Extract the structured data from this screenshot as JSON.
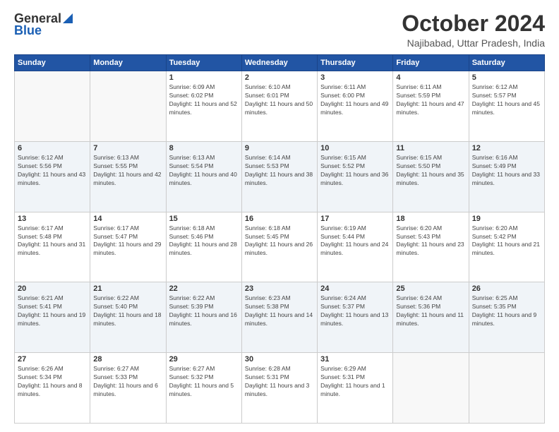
{
  "header": {
    "logo_general": "General",
    "logo_blue": "Blue",
    "title": "October 2024",
    "subtitle": "Najibabad, Uttar Pradesh, India"
  },
  "calendar": {
    "days_of_week": [
      "Sunday",
      "Monday",
      "Tuesday",
      "Wednesday",
      "Thursday",
      "Friday",
      "Saturday"
    ],
    "weeks": [
      [
        {
          "day": "",
          "info": ""
        },
        {
          "day": "",
          "info": ""
        },
        {
          "day": "1",
          "info": "Sunrise: 6:09 AM\nSunset: 6:02 PM\nDaylight: 11 hours and 52 minutes."
        },
        {
          "day": "2",
          "info": "Sunrise: 6:10 AM\nSunset: 6:01 PM\nDaylight: 11 hours and 50 minutes."
        },
        {
          "day": "3",
          "info": "Sunrise: 6:11 AM\nSunset: 6:00 PM\nDaylight: 11 hours and 49 minutes."
        },
        {
          "day": "4",
          "info": "Sunrise: 6:11 AM\nSunset: 5:59 PM\nDaylight: 11 hours and 47 minutes."
        },
        {
          "day": "5",
          "info": "Sunrise: 6:12 AM\nSunset: 5:57 PM\nDaylight: 11 hours and 45 minutes."
        }
      ],
      [
        {
          "day": "6",
          "info": "Sunrise: 6:12 AM\nSunset: 5:56 PM\nDaylight: 11 hours and 43 minutes."
        },
        {
          "day": "7",
          "info": "Sunrise: 6:13 AM\nSunset: 5:55 PM\nDaylight: 11 hours and 42 minutes."
        },
        {
          "day": "8",
          "info": "Sunrise: 6:13 AM\nSunset: 5:54 PM\nDaylight: 11 hours and 40 minutes."
        },
        {
          "day": "9",
          "info": "Sunrise: 6:14 AM\nSunset: 5:53 PM\nDaylight: 11 hours and 38 minutes."
        },
        {
          "day": "10",
          "info": "Sunrise: 6:15 AM\nSunset: 5:52 PM\nDaylight: 11 hours and 36 minutes."
        },
        {
          "day": "11",
          "info": "Sunrise: 6:15 AM\nSunset: 5:50 PM\nDaylight: 11 hours and 35 minutes."
        },
        {
          "day": "12",
          "info": "Sunrise: 6:16 AM\nSunset: 5:49 PM\nDaylight: 11 hours and 33 minutes."
        }
      ],
      [
        {
          "day": "13",
          "info": "Sunrise: 6:17 AM\nSunset: 5:48 PM\nDaylight: 11 hours and 31 minutes."
        },
        {
          "day": "14",
          "info": "Sunrise: 6:17 AM\nSunset: 5:47 PM\nDaylight: 11 hours and 29 minutes."
        },
        {
          "day": "15",
          "info": "Sunrise: 6:18 AM\nSunset: 5:46 PM\nDaylight: 11 hours and 28 minutes."
        },
        {
          "day": "16",
          "info": "Sunrise: 6:18 AM\nSunset: 5:45 PM\nDaylight: 11 hours and 26 minutes."
        },
        {
          "day": "17",
          "info": "Sunrise: 6:19 AM\nSunset: 5:44 PM\nDaylight: 11 hours and 24 minutes."
        },
        {
          "day": "18",
          "info": "Sunrise: 6:20 AM\nSunset: 5:43 PM\nDaylight: 11 hours and 23 minutes."
        },
        {
          "day": "19",
          "info": "Sunrise: 6:20 AM\nSunset: 5:42 PM\nDaylight: 11 hours and 21 minutes."
        }
      ],
      [
        {
          "day": "20",
          "info": "Sunrise: 6:21 AM\nSunset: 5:41 PM\nDaylight: 11 hours and 19 minutes."
        },
        {
          "day": "21",
          "info": "Sunrise: 6:22 AM\nSunset: 5:40 PM\nDaylight: 11 hours and 18 minutes."
        },
        {
          "day": "22",
          "info": "Sunrise: 6:22 AM\nSunset: 5:39 PM\nDaylight: 11 hours and 16 minutes."
        },
        {
          "day": "23",
          "info": "Sunrise: 6:23 AM\nSunset: 5:38 PM\nDaylight: 11 hours and 14 minutes."
        },
        {
          "day": "24",
          "info": "Sunrise: 6:24 AM\nSunset: 5:37 PM\nDaylight: 11 hours and 13 minutes."
        },
        {
          "day": "25",
          "info": "Sunrise: 6:24 AM\nSunset: 5:36 PM\nDaylight: 11 hours and 11 minutes."
        },
        {
          "day": "26",
          "info": "Sunrise: 6:25 AM\nSunset: 5:35 PM\nDaylight: 11 hours and 9 minutes."
        }
      ],
      [
        {
          "day": "27",
          "info": "Sunrise: 6:26 AM\nSunset: 5:34 PM\nDaylight: 11 hours and 8 minutes."
        },
        {
          "day": "28",
          "info": "Sunrise: 6:27 AM\nSunset: 5:33 PM\nDaylight: 11 hours and 6 minutes."
        },
        {
          "day": "29",
          "info": "Sunrise: 6:27 AM\nSunset: 5:32 PM\nDaylight: 11 hours and 5 minutes."
        },
        {
          "day": "30",
          "info": "Sunrise: 6:28 AM\nSunset: 5:31 PM\nDaylight: 11 hours and 3 minutes."
        },
        {
          "day": "31",
          "info": "Sunrise: 6:29 AM\nSunset: 5:31 PM\nDaylight: 11 hours and 1 minute."
        },
        {
          "day": "",
          "info": ""
        },
        {
          "day": "",
          "info": ""
        }
      ]
    ]
  }
}
